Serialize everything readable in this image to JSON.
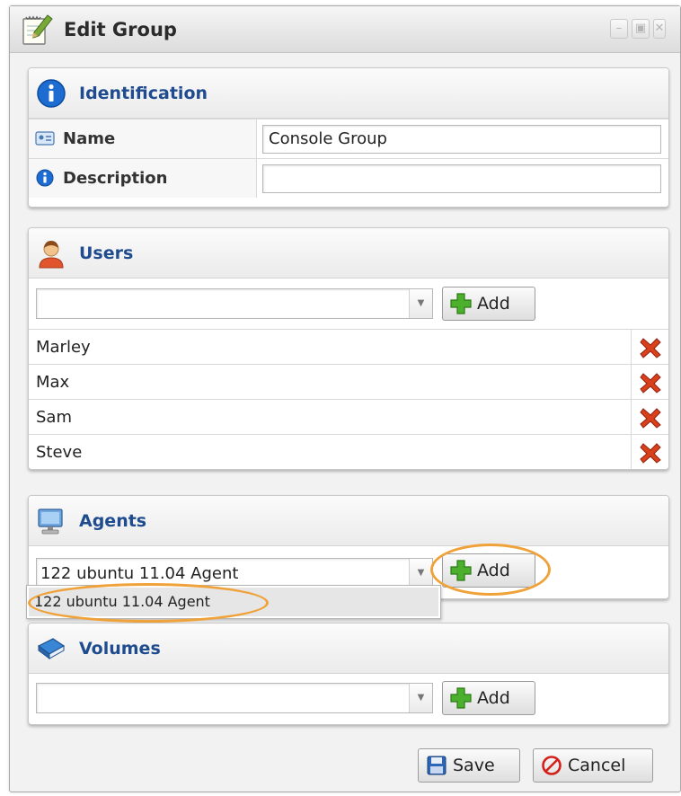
{
  "window": {
    "title": "Edit Group"
  },
  "identification": {
    "title": "Identification",
    "name_label": "Name",
    "name_value": "Console Group",
    "description_label": "Description",
    "description_value": ""
  },
  "users": {
    "title": "Users",
    "combo_value": "",
    "add_label": "Add",
    "items": [
      "Marley",
      "Max",
      "Sam",
      "Steve"
    ]
  },
  "agents": {
    "title": "Agents",
    "combo_value": "122 ubuntu 11.04 Agent",
    "add_label": "Add",
    "dropdown_options": [
      "122 ubuntu 11.04 Agent"
    ]
  },
  "volumes": {
    "title": "Volumes",
    "combo_value": "",
    "add_label": "Add"
  },
  "footer": {
    "save_label": "Save",
    "cancel_label": "Cancel"
  },
  "colors": {
    "panel_title": "#1f4b8f",
    "highlight": "#f0a23a",
    "delete": "#d9401c"
  },
  "icons": {
    "window": "edit-notepad-icon",
    "identification": "info-icon",
    "users": "user-icon",
    "agents": "computer-icon",
    "volumes": "book-icon",
    "add": "green-plus-icon",
    "delete": "red-x-icon",
    "save": "floppy-disk-icon",
    "cancel": "cancel-icon"
  }
}
